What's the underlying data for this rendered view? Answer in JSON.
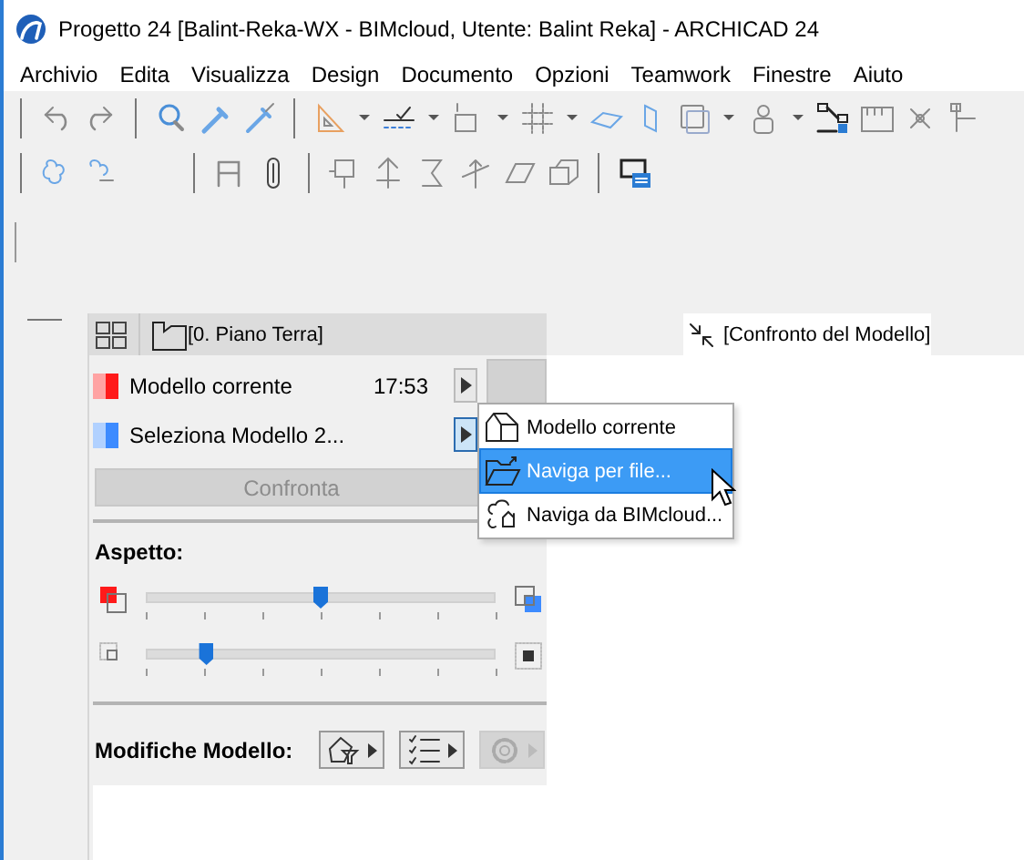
{
  "window": {
    "title": "Progetto 24 [Balint-Reka-WX - BIMcloud, Utente: Balint Reka] - ARCHICAD 24"
  },
  "menu_bar": [
    "Archivio",
    "Edita",
    "Visualizza",
    "Design",
    "Documento",
    "Opzioni",
    "Teamwork",
    "Finestre",
    "Aiuto"
  ],
  "story_tab": {
    "label": "[0. Piano Terra]"
  },
  "view_tab": {
    "label": "[Confronto del Modello]"
  },
  "models": [
    {
      "name": "Modello corrente",
      "time": "17:53",
      "color": "#ff1a1a",
      "menu_open": false
    },
    {
      "name": "Seleziona Modello 2...",
      "color": "#3d8bff",
      "menu_open": true
    }
  ],
  "compare_button": {
    "label": "Confronta",
    "disabled": true
  },
  "appearance": {
    "label": "Aspetto:",
    "sliders": [
      {
        "level": 0.5
      },
      {
        "level": 0.17
      }
    ]
  },
  "changes": {
    "label": "Modifiche Modello:",
    "buttons": [
      {
        "kind": "filter",
        "disabled": false
      },
      {
        "kind": "list",
        "disabled": false
      },
      {
        "kind": "settings",
        "disabled": true
      }
    ]
  },
  "dropdown_menu": {
    "items": [
      {
        "label": "Modello corrente",
        "kind": "current",
        "selected": false
      },
      {
        "label": "Naviga per file...",
        "kind": "file",
        "selected": true
      },
      {
        "label": "Naviga da BIMcloud...",
        "kind": "cloud",
        "selected": false
      }
    ]
  }
}
